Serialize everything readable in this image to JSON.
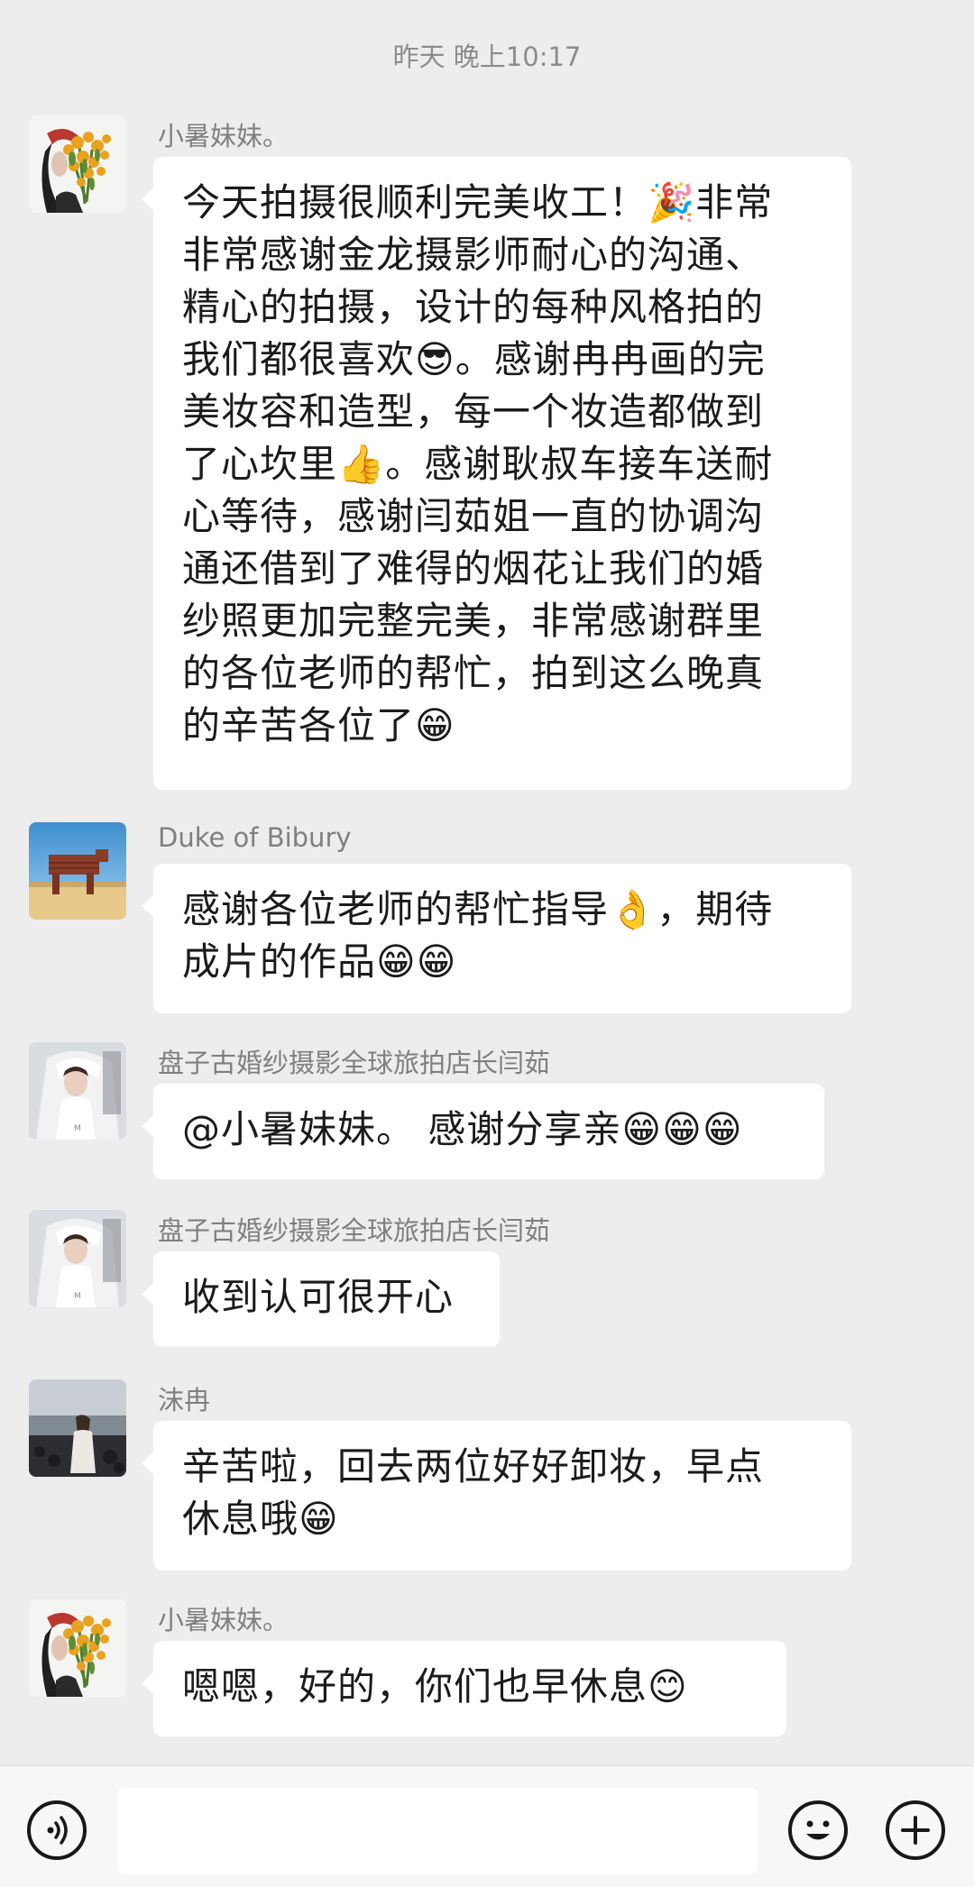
{
  "header": {
    "timestamp": "昨天 晚上10:17"
  },
  "messages": [
    {
      "sender": "小暑妹妹。",
      "avatar_icon": "flowers-portrait-avatar-icon",
      "text": "今天拍摄很顺利完美收工！🎉非常\n非常感谢金龙摄影师耐心的沟通、\n精心的拍摄，设计的每种风格拍的\n我们都很喜欢😎。感谢冉冉画的完\n美妆容和造型，每一个妆造都做到\n了心坎里👍。感谢耿叔车接车送耐\n心等待，感谢闫茹姐一直的协调沟\n通还借到了难得的烟花让我们的婚\n纱照更加完整完美，非常感谢群里\n的各位老师的帮忙，拍到这么晚真\n的辛苦各位了😁"
    },
    {
      "sender": "Duke of Bibury",
      "avatar_icon": "desert-sculpture-avatar-icon",
      "text": "感谢各位老师的帮忙指导👌，期待\n成片的作品😁😁"
    },
    {
      "sender": "盘子古婚纱摄影全球旅拍店长闫茹",
      "avatar_icon": "bride-portrait-avatar-icon",
      "text": "@小暑妹妹。 感谢分享亲😁😁😁"
    },
    {
      "sender": "盘子古婚纱摄影全球旅拍店长闫茹",
      "avatar_icon": "bride-portrait-avatar-icon",
      "text": "收到认可很开心"
    },
    {
      "sender": "沫冉",
      "avatar_icon": "beach-figure-avatar-icon",
      "text": "辛苦啦，回去两位好好卸妆，早点\n休息哦😁"
    },
    {
      "sender": "小暑妹妹。",
      "avatar_icon": "flowers-portrait-avatar-icon",
      "text": "嗯嗯，好的，你们也早休息😊"
    }
  ],
  "input_bar": {
    "voice_icon": "voice-icon",
    "emoji_icon": "emoji-icon",
    "plus_icon": "plus-icon",
    "input_value": ""
  }
}
